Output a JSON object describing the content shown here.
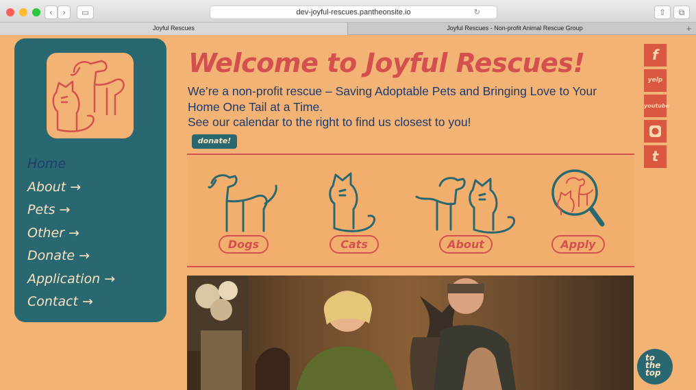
{
  "browser": {
    "url": "dev-joyful-rescues.pantheonsite.io",
    "tabs": [
      "Joyful Rescues",
      "Joyful Rescues - Non-profit Animal Rescue Group"
    ],
    "new_tab": "+"
  },
  "nav": {
    "items": [
      "Home",
      "About →",
      "Pets →",
      "Other →",
      "Donate →",
      "Application →",
      "Contact →"
    ]
  },
  "hero": {
    "title": "Welcome to Joyful Rescues!",
    "line1": "We’re a non-profit rescue – Saving Adoptable Pets and Bringing Love to Your Home One Tail at a Time.",
    "line2": "See our calendar to the right to find us closest to you!",
    "donate": "donate!"
  },
  "categories": [
    "Dogs",
    "Cats",
    "About",
    "Apply"
  ],
  "social": [
    "f",
    "yelp",
    "youtube",
    "t"
  ],
  "totop": [
    "to",
    "the",
    "top"
  ],
  "colors": {
    "bg": "#f3b375",
    "teal": "#296870",
    "red": "#d4504f",
    "navy": "#1e3a6b"
  }
}
